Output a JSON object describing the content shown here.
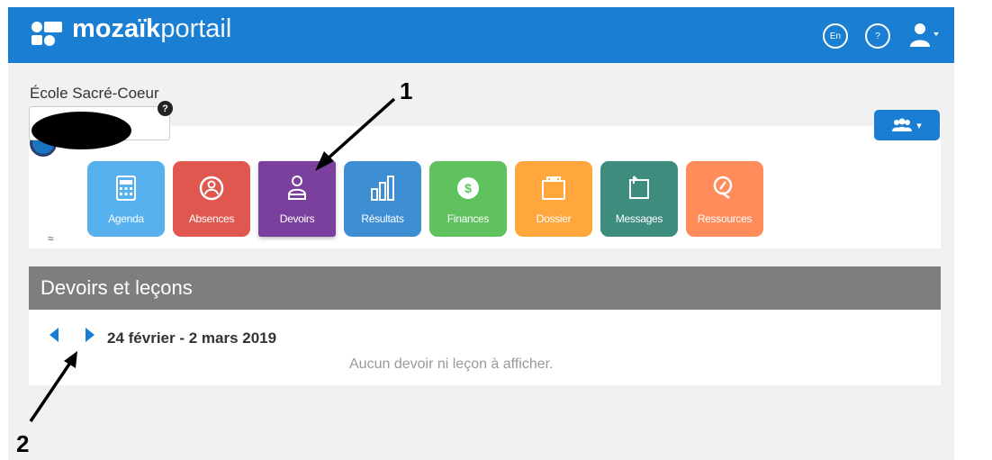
{
  "header": {
    "logo_bold": "mozaïk",
    "logo_light": "portail",
    "lang_button": "En",
    "help_button": "?",
    "user_icon": "user-menu-icon",
    "brand_color": "#1a7ed3"
  },
  "school": {
    "name": "École Sacré-Coeur",
    "help_badge": "?"
  },
  "tiles": [
    {
      "label": "Agenda",
      "icon": "calendar-icon",
      "color": "#56b1ee"
    },
    {
      "label": "Absences",
      "icon": "person-circle-icon",
      "color": "#e0574f"
    },
    {
      "label": "Devoirs",
      "icon": "person-icon",
      "color": "#7b3f9e"
    },
    {
      "label": "Résultats",
      "icon": "bar-chart-icon",
      "color": "#3e8ed4"
    },
    {
      "label": "Finances",
      "icon": "dollar-coin-icon",
      "color": "#5fc25f"
    },
    {
      "label": "Dossier",
      "icon": "folder-icon",
      "color": "#ffa63d"
    },
    {
      "label": "Messages",
      "icon": "message-icon",
      "color": "#3e8c7e"
    },
    {
      "label": "Ressources",
      "icon": "resource-icon",
      "color": "#ff8c5a"
    }
  ],
  "homework": {
    "title": "Devoirs et leçons",
    "week_range": "24 février  - 2 mars 2019",
    "empty_message": "Aucun devoir ni leçon à afficher."
  },
  "annotations": {
    "label_1": "1",
    "label_2": "2"
  }
}
